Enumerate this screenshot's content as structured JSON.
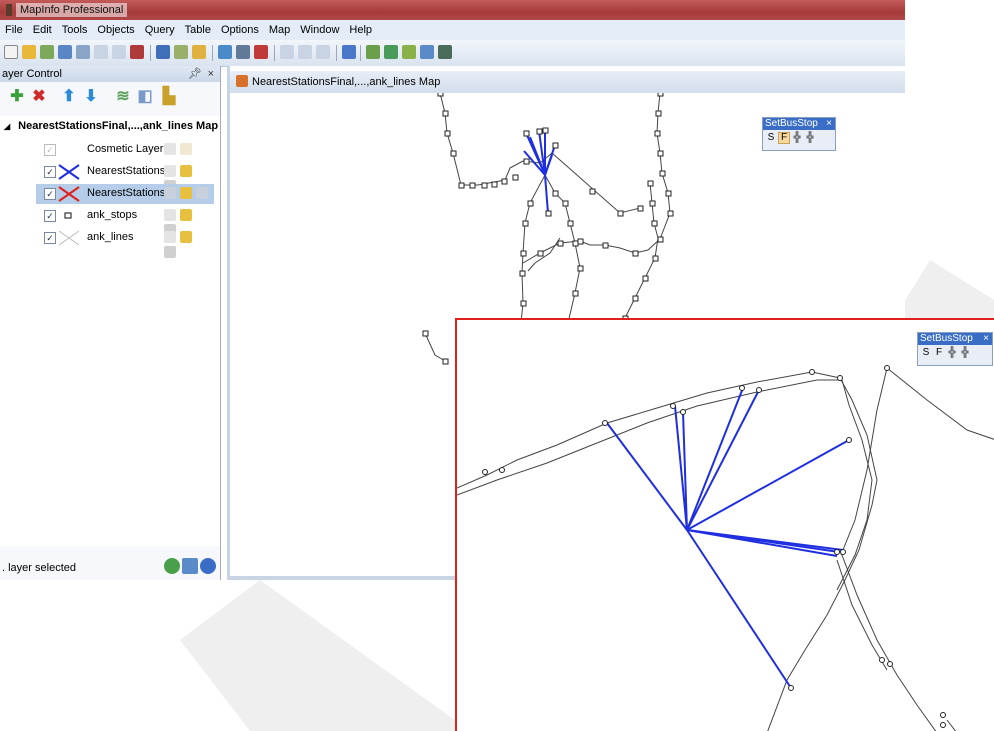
{
  "window": {
    "title": "MapInfo Professional"
  },
  "menu": [
    "File",
    "Edit",
    "Tools",
    "Objects",
    "Query",
    "Table",
    "Options",
    "Map",
    "Window",
    "Help"
  ],
  "layer_control": {
    "title": "ayer Control",
    "pin_glyph": "p",
    "close_glyph": "×",
    "map_name": "NearestStationsFinal,...,ank_lines Map",
    "layers": [
      {
        "name": "Cosmetic Layer",
        "checked": true,
        "selected": false
      },
      {
        "name": "NearestStations",
        "checked": true,
        "selected": false
      },
      {
        "name": "NearestStations",
        "checked": true,
        "selected": true
      },
      {
        "name": "ank_stops",
        "checked": true,
        "selected": false
      },
      {
        "name": "ank_lines",
        "checked": true,
        "selected": false
      }
    ],
    "status": ". layer selected"
  },
  "map_window": {
    "title": "NearestStationsFinal,...,ank_lines Map"
  },
  "palette": {
    "title": "SetBusStop",
    "close_glyph": "×",
    "buttons": [
      "S",
      "F",
      "+",
      "+"
    ],
    "active": "F"
  },
  "palette2": {
    "title": "SetBusStop",
    "close_glyph": "×"
  },
  "colors": {
    "accent_blue": "#1f2fe0",
    "inset_border": "#e0201a"
  }
}
